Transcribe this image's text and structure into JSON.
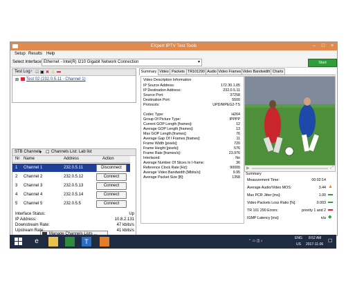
{
  "window": {
    "title": "EXpert IPTV Test Tools"
  },
  "menu": [
    "Setup",
    "Results",
    "Help"
  ],
  "interface": {
    "label": "Select Interface:",
    "value": "Ethernet - Intel(R) I210 Gigabit Network Connection"
  },
  "start_label": "Start",
  "test_log": {
    "title": "Test Log",
    "entry": "Test 02 (232.0.5.11 - Channel 1)"
  },
  "stb": {
    "title": "STB Channels",
    "checkbox_label": "Channels List: Lab list",
    "headers": [
      "Nr",
      "Name",
      "Address",
      "Action"
    ],
    "rows": [
      {
        "nr": "1",
        "name": "Channel 1",
        "address": "232.0.5.11",
        "action": "Disconnect"
      },
      {
        "nr": "2",
        "name": "Channel 2",
        "address": "232.0.5.12",
        "action": "Connect"
      },
      {
        "nr": "3",
        "name": "Channel 3",
        "address": "232.0.5.13",
        "action": "Connect"
      },
      {
        "nr": "4",
        "name": "Channel 4",
        "address": "232.0.5.14",
        "action": "Connect"
      },
      {
        "nr": "5",
        "name": "Channel 5",
        "address": "232.0.5.5",
        "action": "Connect"
      }
    ],
    "manage_label": "Manage Channels Lists ..."
  },
  "status": [
    {
      "label": "Interface Status:",
      "value": "Up"
    },
    {
      "label": "IP Address:",
      "value": "10.8.2.131"
    },
    {
      "label": "Downstream Rate:",
      "value": "47 kbits/s"
    },
    {
      "label": "Upstream Rate:",
      "value": "41 kbits/s"
    }
  ],
  "tabs": [
    "Summary",
    "Video",
    "Packets",
    "TR101290",
    "Audio",
    "Video Frames",
    "Video Bandwidth",
    "Charts"
  ],
  "video_info": {
    "title": "Video Description Information",
    "rows": [
      {
        "k": "IP Source Address:",
        "v": "172.30.1.05"
      },
      {
        "k": "IP Destination Address:",
        "v": "232.0.5.11"
      },
      {
        "k": "Source Port:",
        "v": "37258"
      },
      {
        "k": "Destination Port:",
        "v": "5500"
      },
      {
        "k": "Protocols:",
        "v": "UPD/MPEG2-TS"
      },
      {
        "k": "",
        "v": ""
      },
      {
        "k": "Codec Type:",
        "v": "H264"
      },
      {
        "k": "Group Of Picture Type:",
        "v": "IPPPP"
      },
      {
        "k": "Current GOP Length [frames]:",
        "v": "12"
      },
      {
        "k": "Average GOP Length [frames]:",
        "v": "13"
      },
      {
        "k": "Max GOP Length [frames]:",
        "v": "76"
      },
      {
        "k": "Average Gap Of I Frames [frames]:",
        "v": "11"
      },
      {
        "k": "Frame Width [pixels]:",
        "v": "720"
      },
      {
        "k": "Frame Height [pixels]:",
        "v": "576"
      },
      {
        "k": "Frame Rate [frames/s]:",
        "v": "23.976"
      },
      {
        "k": "Interlaced:",
        "v": "No"
      },
      {
        "k": "Average Number Of Slices In I-frame:",
        "v": "36"
      },
      {
        "k": "Reference Clock Rate [Hz]:",
        "v": "90000"
      },
      {
        "k": "Average Video Bandwidth [Mbits/s]:",
        "v": "9.95"
      },
      {
        "k": "Average Packet Size [B]:",
        "v": "1358"
      }
    ]
  },
  "summary": {
    "title": "Summary",
    "rows": [
      {
        "k": "Measurement Time:",
        "v": "00:02:14",
        "icon": ""
      },
      {
        "k": "Average Audio/Video MOS:",
        "v": "3.44",
        "icon": "warning-icon"
      },
      {
        "k": "Max PCR Jitter [ms]:",
        "v": "1.00",
        "icon": "ok-icon"
      },
      {
        "k": "Video Packets Loss Ratio [%]:",
        "v": "0.003",
        "icon": "ok-icon"
      },
      {
        "k": "TR 101 290 Errors:",
        "v": "priority 1 and 2",
        "icon": "error-icon"
      },
      {
        "k": "IGMP Latency [ms]:",
        "v": "n/a",
        "icon": "info-icon"
      }
    ]
  },
  "taskbar": {
    "lang": "ENG",
    "region": "US",
    "time": "8:52 AM",
    "date": "2017-11-06"
  },
  "colors": {
    "accent": "#e08a4e",
    "start": "#2f9e3a",
    "selected_row": "#1f3f99",
    "taskbar": "#1e2b40"
  }
}
